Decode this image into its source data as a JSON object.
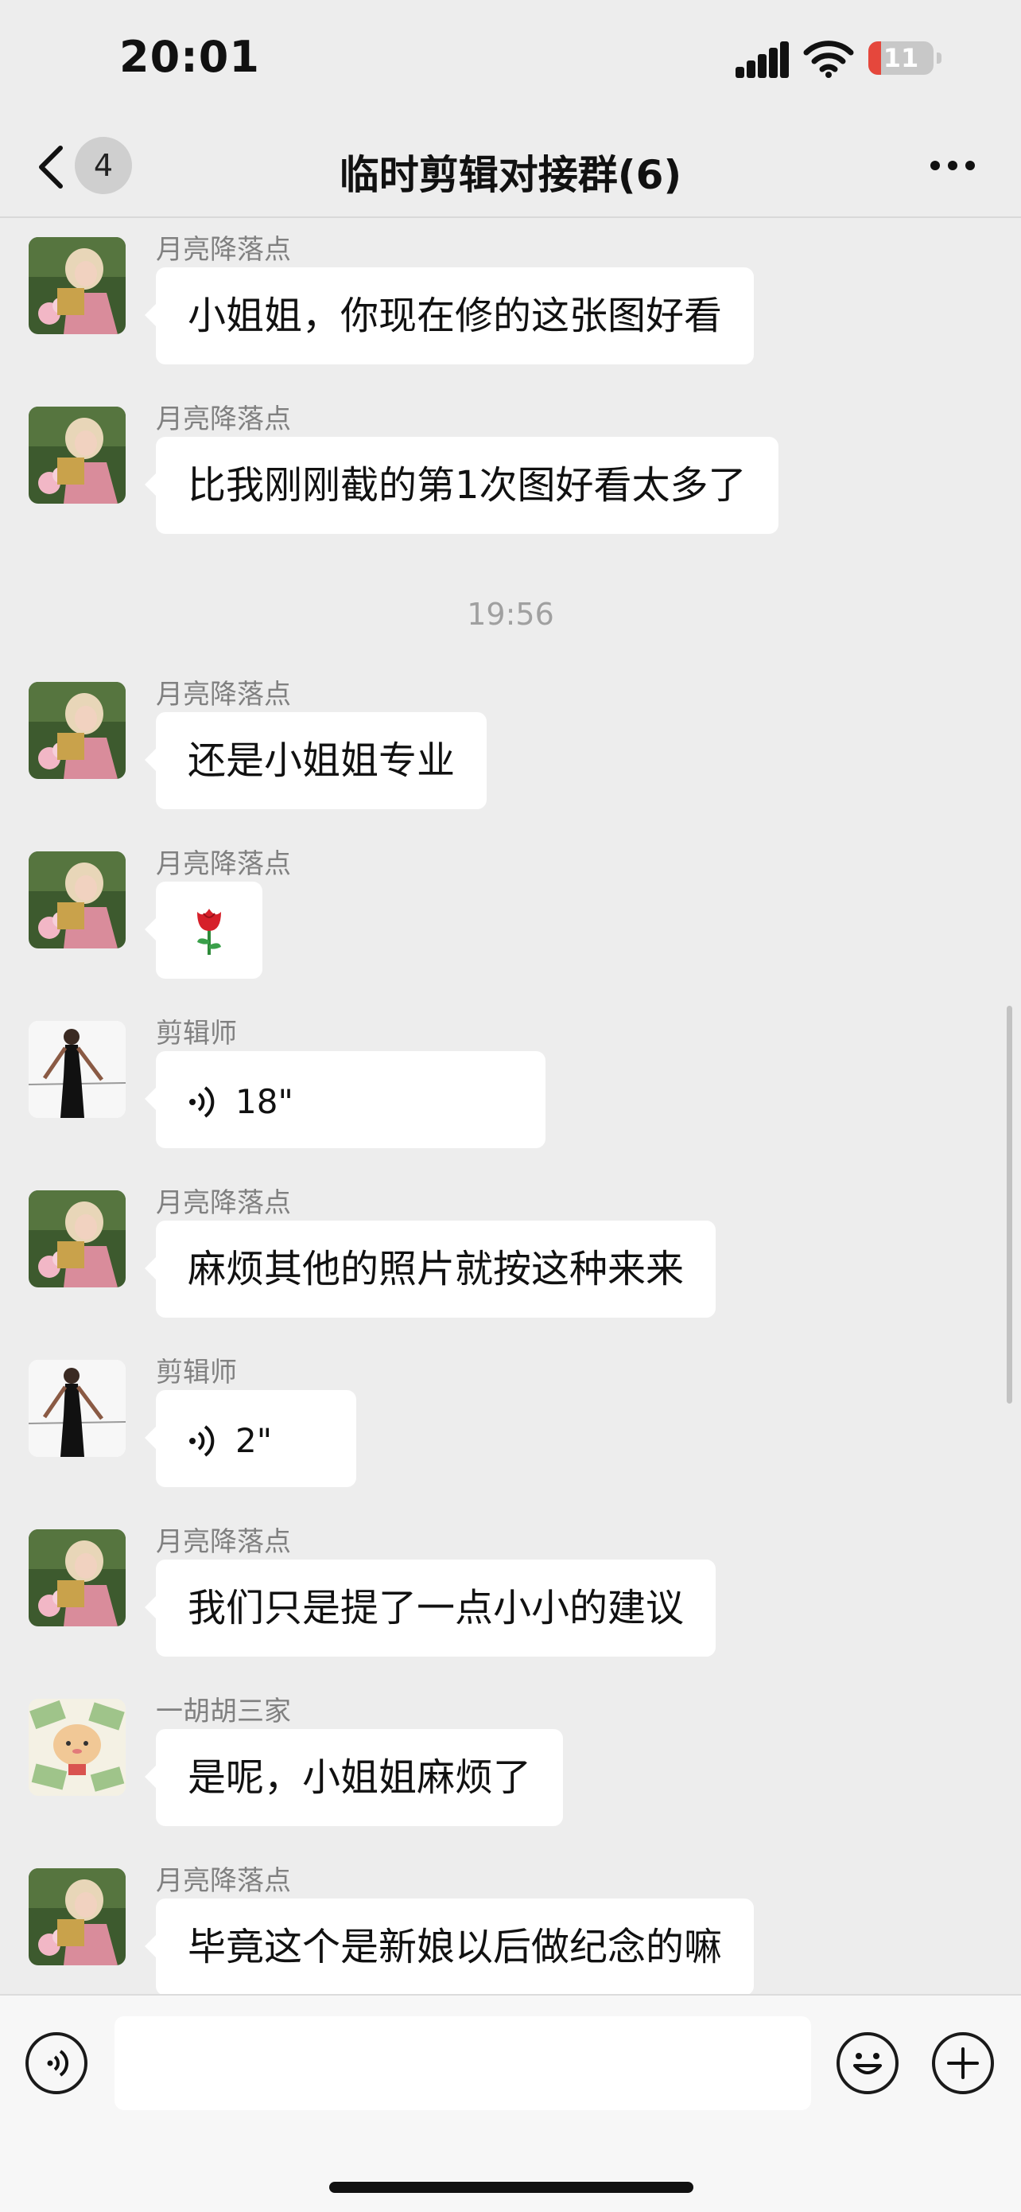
{
  "status": {
    "time": "20:01",
    "battery": "11"
  },
  "header": {
    "unread_count": "4",
    "title": "临时剪辑对接群(6)"
  },
  "messages": [
    {
      "sender": "月亮降落点",
      "text": "小姐姐，你现在修的这张图好看",
      "kind": "text"
    },
    {
      "sender": "月亮降落点",
      "text": "比我刚刚截的第1次图好看太多了",
      "kind": "text"
    },
    {
      "timestamp": "19:56"
    },
    {
      "sender": "月亮降落点",
      "text": "还是小姐姐专业",
      "kind": "text"
    },
    {
      "sender": "月亮降落点",
      "text": "🌹",
      "kind": "emoji"
    },
    {
      "sender": "剪辑师",
      "text": "18\"",
      "kind": "voice"
    },
    {
      "sender": "月亮降落点",
      "text": "麻烦其他的照片就按这种来来",
      "kind": "text"
    },
    {
      "sender": "剪辑师",
      "text": "2\"",
      "kind": "voice"
    },
    {
      "sender": "月亮降落点",
      "text": "我们只是提了一点小小的建议",
      "kind": "text"
    },
    {
      "sender": "一胡胡三家",
      "text": "是呢，小姐姐麻烦了",
      "kind": "text"
    },
    {
      "sender": "月亮降落点",
      "text": "毕竟这个是新娘以后做纪念的嘛",
      "kind": "text"
    }
  ],
  "colors": {
    "background": "#ededed",
    "bubble": "#ffffff",
    "sender_name": "#808080"
  }
}
